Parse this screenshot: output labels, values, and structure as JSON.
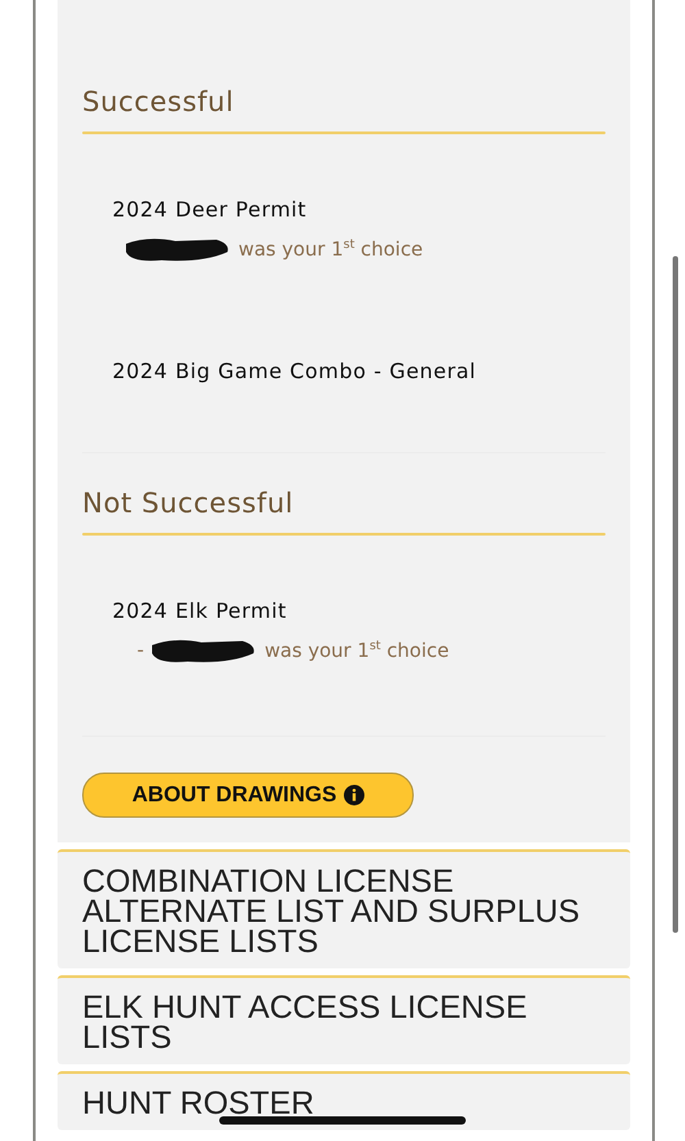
{
  "sections": [
    {
      "heading": "Successful",
      "items": [
        {
          "title": "2024 Deer Permit",
          "redacted": true,
          "choice": "was your 1$^{st}$ choice"
        },
        {
          "title": "2024 Big Game Combo - General"
        }
      ]
    },
    {
      "heading": "Not Successful",
      "items": [
        {
          "title": "2024 Elk Permit",
          "redacted": true,
          "prefix": "-",
          "choice": "was your 1$^{st}$ choice"
        }
      ]
    }
  ],
  "about_button": {
    "label": "ABOUT DRAWINGS"
  },
  "cards": [
    {
      "title": "COMBINATION LICENSE ALTERNATE LIST AND SURPLUS LICENSE LISTS"
    },
    {
      "title": "ELK HUNT ACCESS LICENSE LISTS"
    },
    {
      "title": "HUNT ROSTER"
    }
  ]
}
